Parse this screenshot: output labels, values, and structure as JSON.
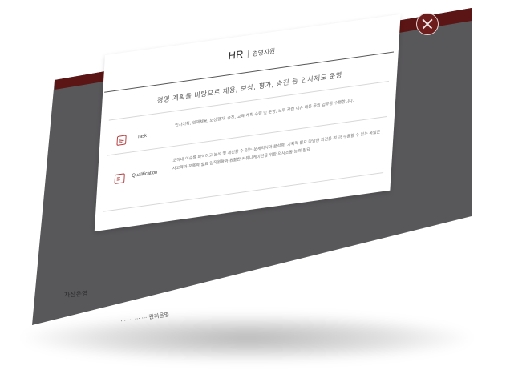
{
  "modal": {
    "title_main": "HR",
    "title_sub": "경영지원",
    "headline": "경영 계획을 바탕으로 채용, 보상, 평가, 승진 등 인사제도 운영",
    "rows": [
      {
        "label": "Task",
        "icon": "document-icon",
        "desc": "인사기획, 인재채용, 보상평가, 승진, 교육 계획 수립 및 운영, 노무 관련 이슈 대응 등의 업무를 수행합니다."
      },
      {
        "label": "Qualification",
        "icon": "person-card-icon",
        "desc": "조직내 이슈를 파악하고 분석 및 개선할 수 있는 문제의식과 분석력, 기획력 필요 다양한 의견을 적 극 수용할 수 있는 폭넓은 사고력과 포용력 필요 임직원들과 원활한 커뮤니케이션을 위한 의사소통 능력 필요"
      }
    ]
  },
  "background": {
    "section_label": "자산운영",
    "footer_text": "··· ··· ··· ··· 관리운영"
  },
  "colors": {
    "accent": "#5a1514",
    "page_bg": "#58575a",
    "icon_red": "#b33a3a"
  }
}
